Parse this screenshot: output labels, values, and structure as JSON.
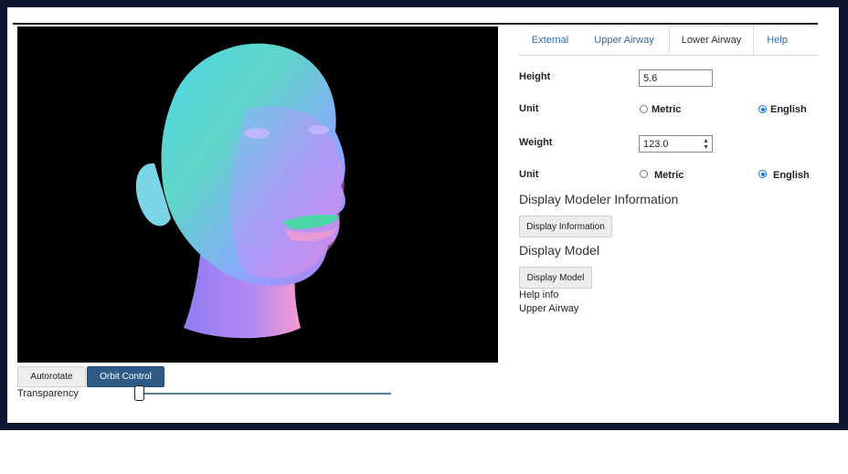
{
  "viewer": {
    "autorotate_label": "Autorotate",
    "orbit_label": "Orbit Control",
    "transparency_label": "Transparency",
    "transparency_value": 0.0
  },
  "tabs": [
    {
      "label": "External",
      "active": false
    },
    {
      "label": "Upper Airway",
      "active": false
    },
    {
      "label": "Lower Airway",
      "active": true
    },
    {
      "label": "Help",
      "active": false
    }
  ],
  "form": {
    "height_label": "Height",
    "height_value": "5.6",
    "unit1_label": "Unit",
    "unit1_metric": "Metric",
    "unit1_english": "English",
    "unit1_selected": "English",
    "weight_label": "Weight",
    "weight_value": "123.0",
    "unit2_label": "Unit",
    "unit2_metric": "Metric",
    "unit2_english": "English",
    "unit2_selected": "English"
  },
  "sections": {
    "modeler_heading": "Display Modeler Information",
    "modeler_button": "Display Information",
    "model_heading": "Display Model",
    "model_button": "Display Model",
    "help_info": "Help info",
    "upper_airway": "Upper Airway"
  },
  "colors": {
    "primary_button": "#2e5b86",
    "tab_link": "#2f6aa8",
    "radio_checked": "#1a73e8"
  }
}
